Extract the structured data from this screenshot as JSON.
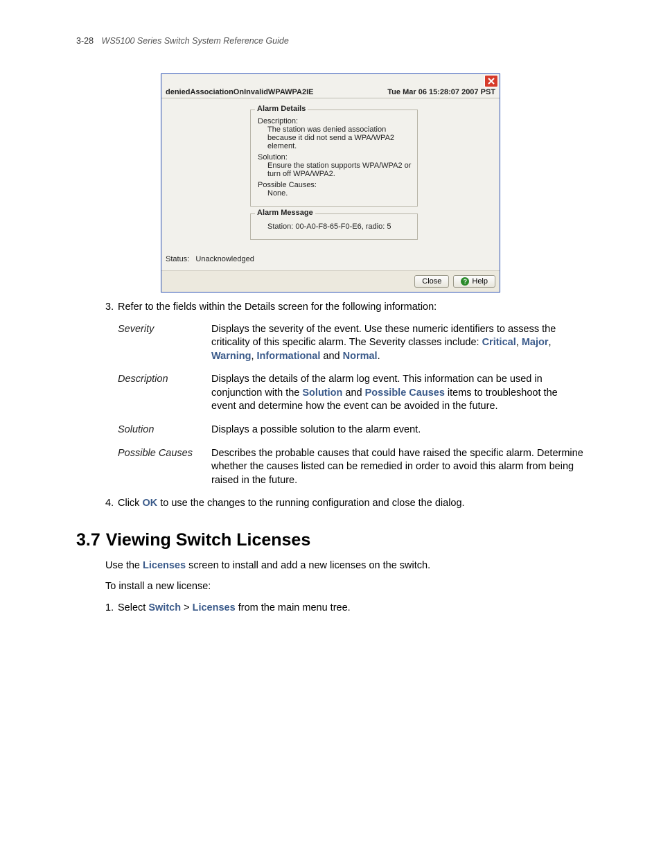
{
  "running_head": {
    "page_num": "3-28",
    "title": "WS5100 Series Switch System Reference Guide"
  },
  "dialog": {
    "header_left": "deniedAssociationOnInvalidWPAWPA2IE",
    "header_right": "Tue Mar 06 15:28:07 2007 PST",
    "details_legend": "Alarm Details",
    "desc_label": "Description:",
    "desc_text": "The station was denied association because it did not send a WPA/WPA2 element.",
    "sol_label": "Solution:",
    "sol_text": "Ensure the station supports WPA/WPA2 or turn off WPA/WPA2.",
    "pc_label": "Possible Causes:",
    "pc_text": "None.",
    "msg_legend": "Alarm Message",
    "msg_text": "Station: 00-A0-F8-65-F0-E6, radio: 5",
    "status_label": "Status:",
    "status_value": "Unacknowledged",
    "close_btn": "Close",
    "help_btn": "Help"
  },
  "step3": "Refer to the fields within the Details screen for the following information:",
  "defs": {
    "severity": {
      "term": "Severity",
      "pre": "Displays the severity of the event. Use these numeric identifiers to assess the criticality of this specific alarm. The Severity classes include: ",
      "c1": "Critical",
      "c2": "Major",
      "c3": "Warning",
      "c4": "Informational",
      "and": " and ",
      "c5": "Normal",
      "dot": "."
    },
    "description": {
      "term": "Description",
      "pre": "Displays the details of the alarm log event. This information can be used in conjunction with the ",
      "b1": "Solution",
      "mid": " and ",
      "b2": "Possible Causes",
      "post": " items to troubleshoot the event and determine how the event can be avoided in the future."
    },
    "solution": {
      "term": "Solution",
      "text": "Displays a possible solution to the alarm event."
    },
    "possible": {
      "term": "Possible Causes",
      "text": "Describes the probable causes that could have raised the specific alarm. Determine whether the causes listed can be remedied in order to avoid this alarm from being raised in the future."
    }
  },
  "step4": {
    "pre": "Click ",
    "ok": "OK",
    "post": " to use the changes to the running configuration and close the dialog."
  },
  "section": {
    "num": "3.7",
    "title": "Viewing Switch Licenses"
  },
  "para1": {
    "pre": "Use the ",
    "link": "Licenses",
    "post": " screen to install and add a new licenses on the switch."
  },
  "para2": "To install a new license:",
  "step1b": {
    "pre": "Select ",
    "b1": "Switch",
    "gt": " > ",
    "b2": "Licenses",
    "post": " from the main menu tree."
  }
}
